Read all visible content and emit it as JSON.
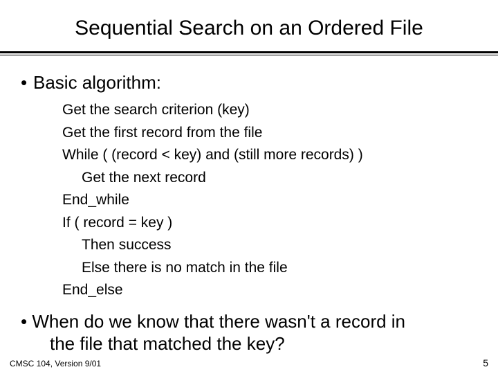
{
  "title": "Sequential Search on an Ordered File",
  "bullet1_label": "Basic algorithm:",
  "algo": {
    "l1": "Get the search criterion (key)",
    "l2": "Get the first record from the file",
    "l3": "While ( (record < key)  and  (still more records) )",
    "l4": "Get the next record",
    "l5": "End_while",
    "l6": "If ( record = key )",
    "l7": "Then success",
    "l8": "Else there is no match in the file",
    "l9": "End_else"
  },
  "bullet2_line1": "• When do we know that there wasn't a record in",
  "bullet2_line2": "the file that matched the key?",
  "footer_left": "CMSC 104, Version 9/01",
  "footer_right": "5"
}
